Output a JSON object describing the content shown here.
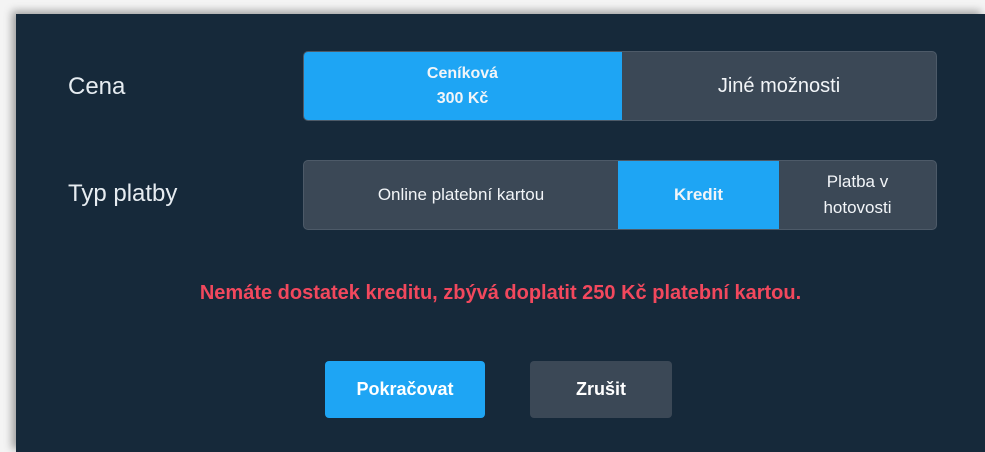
{
  "price": {
    "label": "Cena",
    "options": [
      {
        "line1": "Ceníková",
        "line2": "300 Kč",
        "selected": true
      },
      {
        "line1": "Jiné možnosti",
        "selected": false
      }
    ]
  },
  "payment": {
    "label": "Typ platby",
    "options": [
      {
        "label": "Online platební kartou",
        "selected": false
      },
      {
        "label": "Kredit",
        "selected": true
      },
      {
        "line1": "Platba v",
        "line2": "hotovosti",
        "selected": false
      }
    ]
  },
  "error_message": "Nemáte dostatek kreditu, zbývá doplatit  250 Kč platební kartou.",
  "actions": {
    "continue_label": "Pokračovat",
    "cancel_label": "Zrušit"
  },
  "colors": {
    "background": "#16293a",
    "accent": "#1ea5f4",
    "segment": "#3b4856",
    "error": "#f2485d"
  }
}
